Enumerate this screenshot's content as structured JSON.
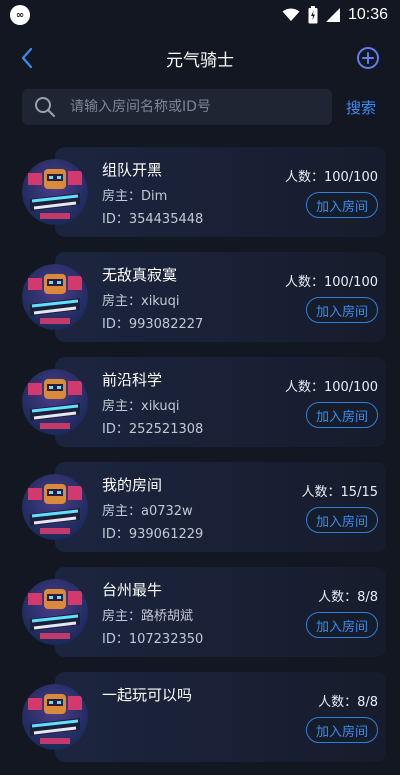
{
  "status_bar": {
    "time": "10:36",
    "app_badge": "∞"
  },
  "nav": {
    "title": "元气骑士"
  },
  "search": {
    "placeholder": "请输入房间名称或ID号",
    "button_label": "搜索"
  },
  "rooms": [
    {
      "name": "组队开黑",
      "owner": "房主：Dim",
      "id": "ID：354435448",
      "count": "人数：100/100",
      "join_label": "加入房间"
    },
    {
      "name": "无敌真寂寞",
      "owner": "房主：xikuqi",
      "id": "ID：993082227",
      "count": "人数：100/100",
      "join_label": "加入房间"
    },
    {
      "name": "前沿科学",
      "owner": "房主：xikuqi",
      "id": "ID：252521308",
      "count": "人数：100/100",
      "join_label": "加入房间"
    },
    {
      "name": "我的房间",
      "owner": "房主：a0732w",
      "id": "ID：939061229",
      "count": "人数：15/15",
      "join_label": "加入房间"
    },
    {
      "name": "台州最牛",
      "owner": "房主：路桥胡斌",
      "id": "ID：107232350",
      "count": "人数：8/8",
      "join_label": "加入房间"
    },
    {
      "name": "一起玩可以吗",
      "owner": "",
      "id": "",
      "count": "人数：8/8",
      "join_label": "加入房间"
    }
  ],
  "colors": {
    "background": "#131722",
    "accent": "#3a8cf0",
    "card": "#1c2540"
  },
  "icons": [
    "back-arrow-icon",
    "add-circle-icon",
    "search-icon",
    "wifi-icon",
    "battery-icon",
    "cellular-icon"
  ]
}
